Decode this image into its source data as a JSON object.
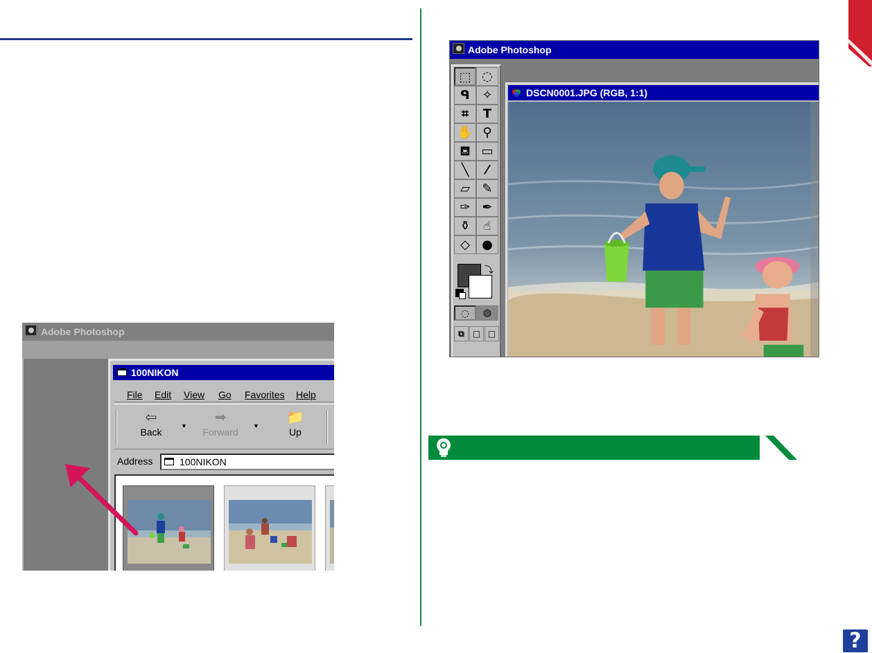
{
  "left_screenshot": {
    "app_title": "Adobe Photoshop",
    "explorer": {
      "title": "100NIKON",
      "menu": [
        "File",
        "Edit",
        "View",
        "Go",
        "Favorites",
        "Help"
      ],
      "toolbar": {
        "back_label": "Back",
        "forward_label": "Forward",
        "up_label": "Up"
      },
      "address_label": "Address",
      "address_value": "100NIKON"
    }
  },
  "right_screenshot": {
    "app_title": "Adobe Photoshop",
    "document_title": "DSCN0001.JPG  (RGB, 1:1)"
  },
  "help_button_label": "?",
  "colors": {
    "rule_blue": "#1f3b8a",
    "divider_green": "#1a8a3a",
    "tip_green": "#008a3c",
    "accent_red": "#d01f2f",
    "arrow_pink": "#d4145a",
    "win_title_blue": "#0000a8"
  },
  "icons": {
    "tip": "lightbulb-icon",
    "help": "question-icon"
  }
}
